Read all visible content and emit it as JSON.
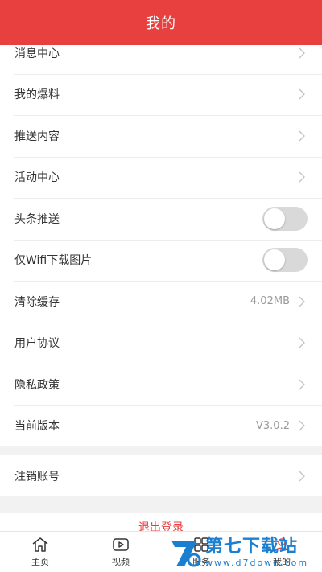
{
  "header": {
    "title": "我的"
  },
  "settings": {
    "items": [
      {
        "label": "消息中心",
        "kind": "chevron"
      },
      {
        "label": "我的爆料",
        "kind": "chevron"
      },
      {
        "label": "推送内容",
        "kind": "chevron"
      },
      {
        "label": "活动中心",
        "kind": "chevron"
      },
      {
        "label": "头条推送",
        "kind": "toggle",
        "on": false
      },
      {
        "label": "仅Wifi下载图片",
        "kind": "toggle",
        "on": false
      },
      {
        "label": "清除缓存",
        "kind": "chevron",
        "value": "4.02MB"
      },
      {
        "label": "用户协议",
        "kind": "chevron"
      },
      {
        "label": "隐私政策",
        "kind": "chevron"
      },
      {
        "label": "当前版本",
        "kind": "chevron",
        "value": "V3.0.2"
      }
    ]
  },
  "account": {
    "cancel_label": "注销账号"
  },
  "logout": {
    "label": "退出登录"
  },
  "tabbar": {
    "tabs": [
      {
        "label": "主页",
        "icon": "home-icon"
      },
      {
        "label": "视频",
        "icon": "video-icon"
      },
      {
        "label": "服务",
        "icon": "service-icon"
      },
      {
        "label": "我的",
        "icon": "profile-icon"
      }
    ]
  },
  "watermark": {
    "title": "第七下载站",
    "url": "www.d7down.com"
  },
  "colors": {
    "accent": "#e8403f",
    "toggle_off": "#d9d9d9",
    "watermark": "#1b7fd1"
  }
}
